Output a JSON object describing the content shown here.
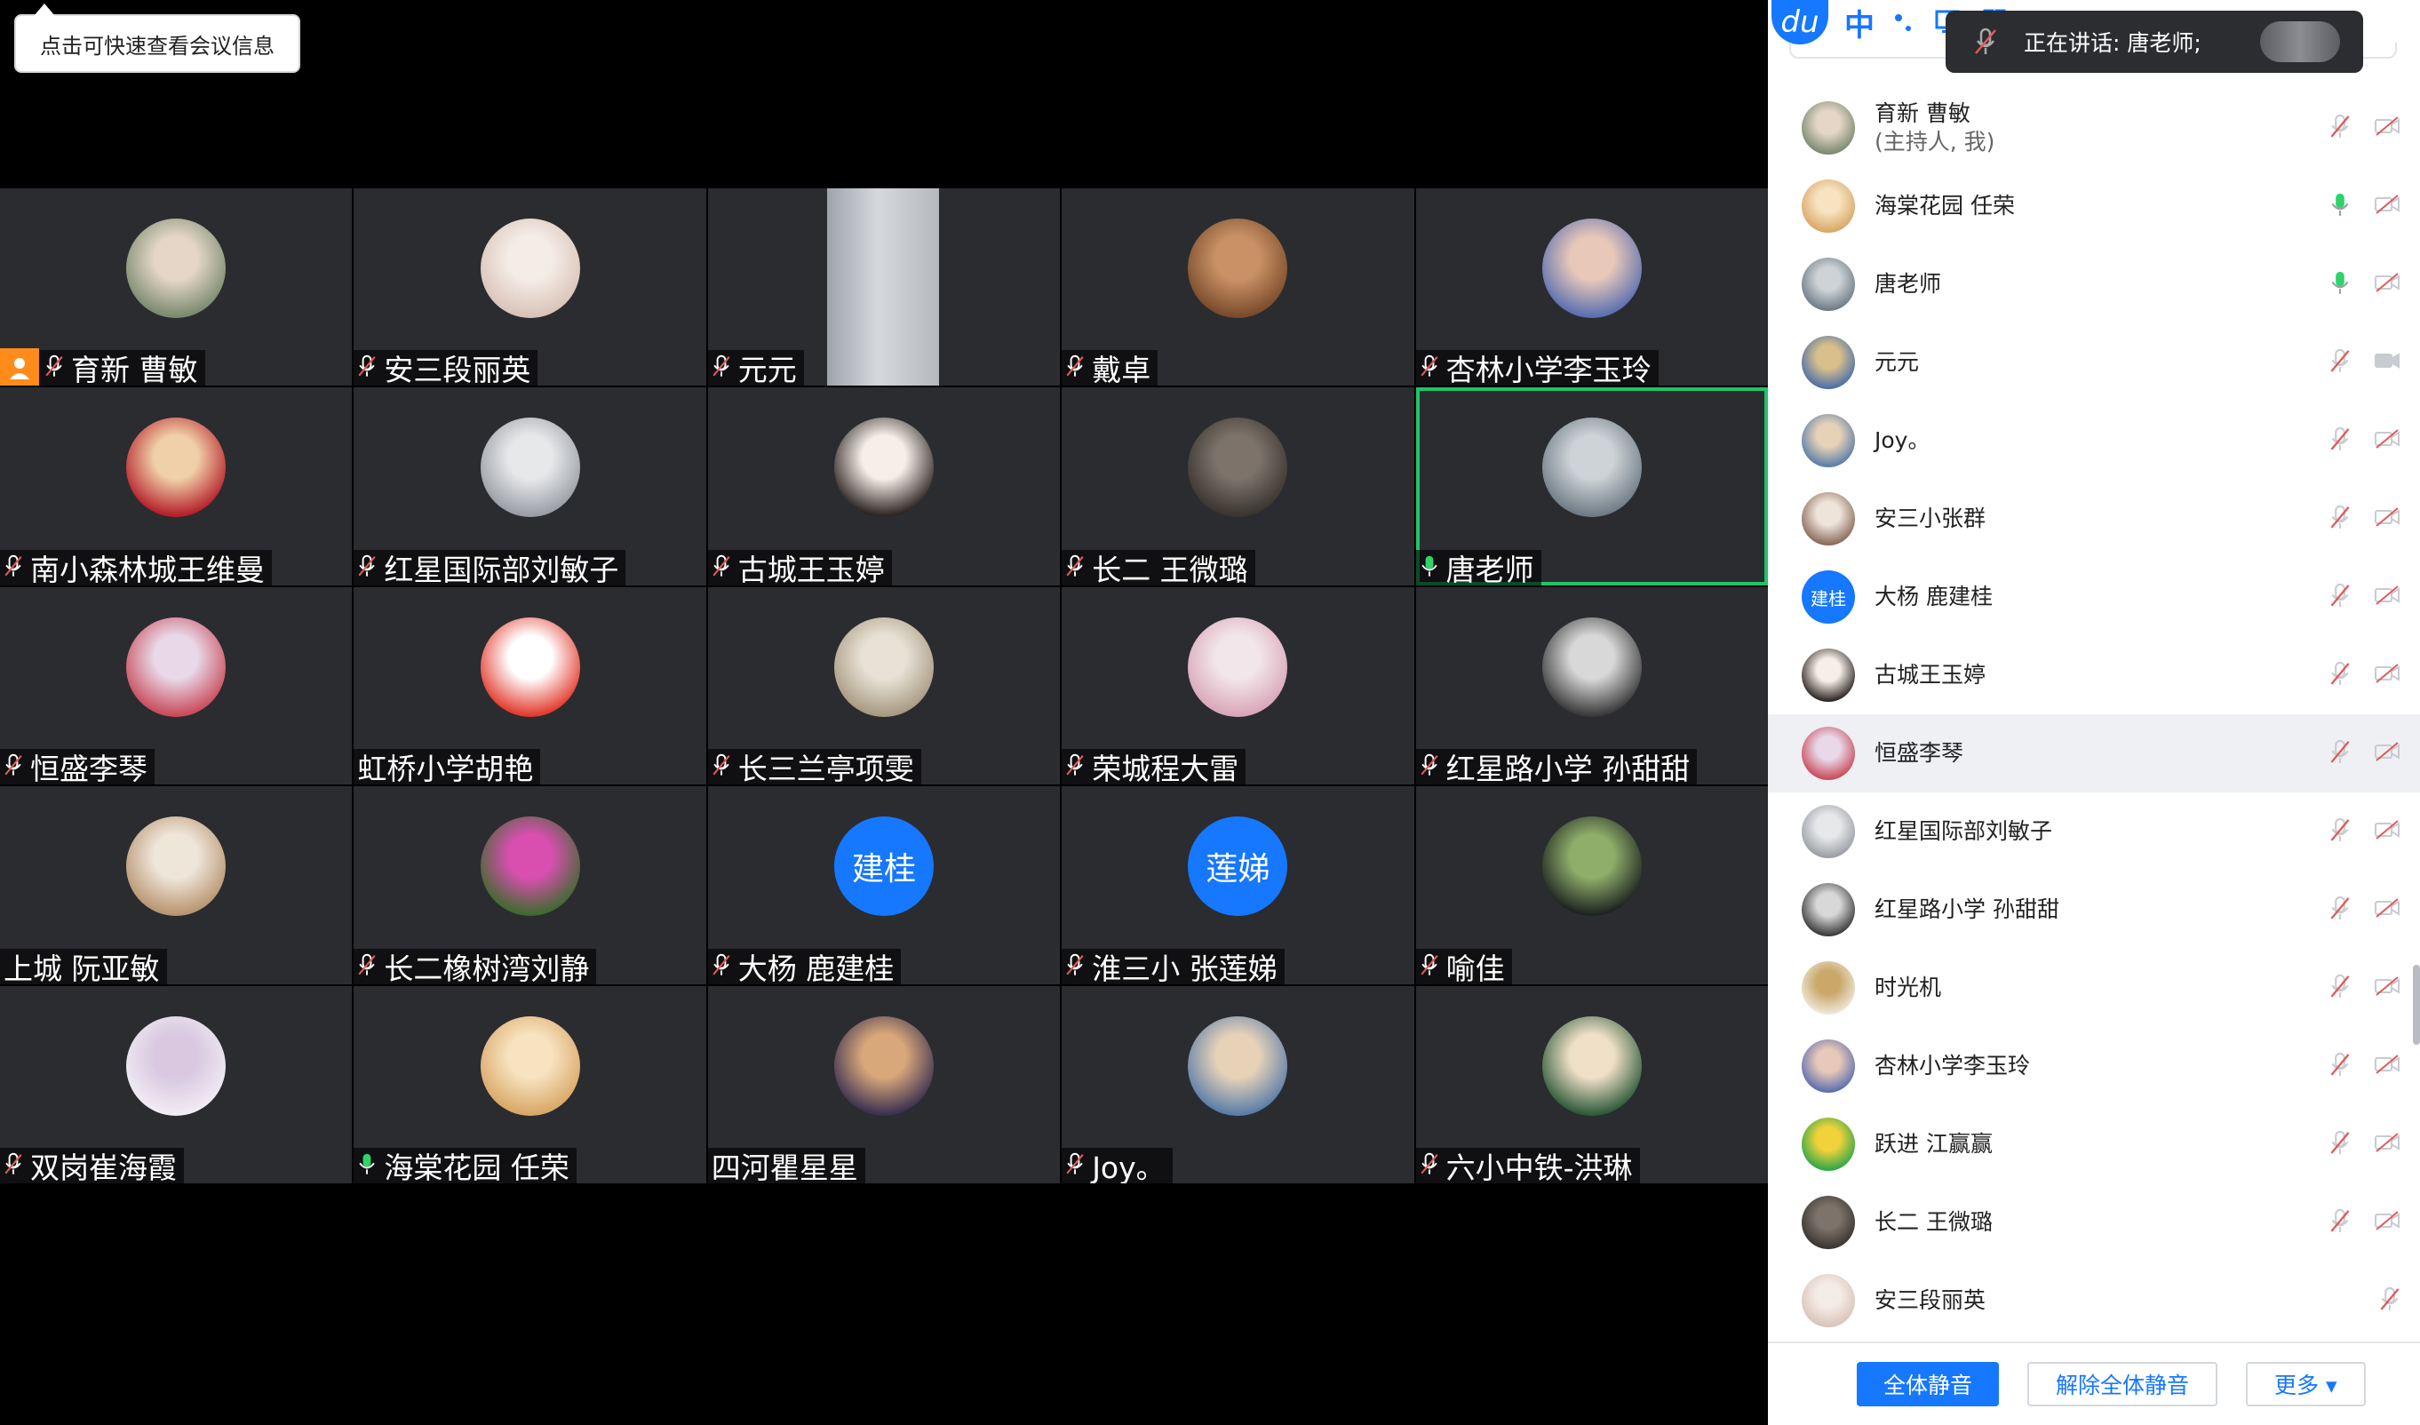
{
  "tooltip": {
    "text": "点击可快速查看会议信息"
  },
  "ime": {
    "logo": "du",
    "lang": "中"
  },
  "speaking": {
    "text": "正在讲话: 唐老师;"
  },
  "tiles": [
    {
      "name": "育新 曹敏",
      "host": true,
      "mic": "muted",
      "avatar": "photo",
      "c1": "#7a8a6e",
      "c2": "#e5d6c8"
    },
    {
      "name": "安三段丽英",
      "mic": "muted",
      "avatar": "photo",
      "c1": "#d9c3b8",
      "c2": "#f4ede6"
    },
    {
      "name": "元元",
      "mic": "muted",
      "avatar": "video"
    },
    {
      "name": "戴卓",
      "mic": "muted",
      "avatar": "photo",
      "c1": "#7a4b2b",
      "c2": "#c99266"
    },
    {
      "name": "杏林小学李玉玲",
      "mic": "muted",
      "avatar": "photo",
      "c1": "#5b6fb0",
      "c2": "#e8c8b8"
    },
    {
      "name": "南小森林城王维曼",
      "mic": "muted",
      "avatar": "photo",
      "c1": "#b5202a",
      "c2": "#f0d0a8"
    },
    {
      "name": "红星国际部刘敏子",
      "mic": "muted",
      "avatar": "photo",
      "c1": "#9a9ea4",
      "c2": "#e7e8ea"
    },
    {
      "name": "古城王玉婷",
      "mic": "muted",
      "avatar": "photo",
      "c1": "#2e2624",
      "c2": "#f6efe8"
    },
    {
      "name": "长二 王微璐",
      "mic": "muted",
      "avatar": "photo",
      "c1": "#3a3530",
      "c2": "#7d736a"
    },
    {
      "name": "唐老师",
      "mic": "on",
      "avatar": "photo",
      "active": true,
      "c1": "#6f7b86",
      "c2": "#cdd3d6"
    },
    {
      "name": "恒盛李琴",
      "mic": "muted",
      "avatar": "photo",
      "c1": "#c94b5a",
      "c2": "#e8d8e8"
    },
    {
      "name": "虹桥小学胡艳",
      "mic": "none",
      "avatar": "photo",
      "c1": "#e23b2e",
      "c2": "#ffffff"
    },
    {
      "name": "长三兰亭项雯",
      "mic": "muted",
      "avatar": "photo",
      "c1": "#a89a82",
      "c2": "#e8e2d6"
    },
    {
      "name": "荣城程大雷",
      "mic": "muted",
      "avatar": "photo",
      "c1": "#d9a6b8",
      "c2": "#f2e6ea"
    },
    {
      "name": "红星路小学 孙甜甜",
      "mic": "muted",
      "avatar": "photo",
      "c1": "#3a3a3a",
      "c2": "#d8d8d8"
    },
    {
      "name": "上城 阮亚敏",
      "mic": "none",
      "avatar": "photo",
      "c1": "#b89570",
      "c2": "#efe6da"
    },
    {
      "name": "长二橡树湾刘静",
      "mic": "muted",
      "avatar": "photo",
      "c1": "#3f6a2e",
      "c2": "#d94fb0"
    },
    {
      "name": "大杨 鹿建桂",
      "mic": "muted",
      "avatar": "text",
      "label": "建桂"
    },
    {
      "name": "淮三小 张莲娣",
      "mic": "muted",
      "avatar": "text",
      "label": "莲娣"
    },
    {
      "name": "喻佳",
      "mic": "muted",
      "avatar": "photo",
      "c1": "#1e2420",
      "c2": "#8fae6a"
    },
    {
      "name": "双岗崔海霞",
      "mic": "muted",
      "avatar": "photo",
      "c1": "#f1ecf4",
      "c2": "#d9c8e0"
    },
    {
      "name": "海棠花园 任荣",
      "mic": "on",
      "avatar": "photo",
      "c1": "#d9a766",
      "c2": "#f7e3c0"
    },
    {
      "name": "四河瞿星星",
      "mic": "none",
      "avatar": "photo",
      "c1": "#3b3150",
      "c2": "#d9a87a"
    },
    {
      "name": "Joy。",
      "mic": "muted",
      "avatar": "photo",
      "c1": "#5a7da8",
      "c2": "#e7d2b8"
    },
    {
      "name": "六小中铁-洪琳",
      "mic": "muted",
      "avatar": "photo",
      "c1": "#2f5b3a",
      "c2": "#f0e0c8"
    }
  ],
  "participants": [
    {
      "name": "育新 曹敏",
      "sub": "(主持人, 我)",
      "mic": "muted",
      "cam": "off",
      "c1": "#7a8a6e",
      "c2": "#e5d6c8"
    },
    {
      "name": "海棠花园 任荣",
      "mic": "on",
      "cam": "off",
      "c1": "#d9a766",
      "c2": "#f7e3c0"
    },
    {
      "name": "唐老师",
      "mic": "on",
      "cam": "off",
      "c1": "#6f7b86",
      "c2": "#cdd3d6"
    },
    {
      "name": "元元",
      "mic": "muted",
      "cam": "on",
      "c1": "#4b6fa8",
      "c2": "#d9c08a"
    },
    {
      "name": "Joy。",
      "mic": "muted",
      "cam": "off",
      "c1": "#5a7da8",
      "c2": "#e7d2b8"
    },
    {
      "name": "安三小张群",
      "mic": "muted",
      "cam": "off",
      "c1": "#8a6a5a",
      "c2": "#efe4da"
    },
    {
      "name": "大杨 鹿建桂",
      "mic": "muted",
      "cam": "off",
      "text": "建桂"
    },
    {
      "name": "古城王玉婷",
      "mic": "muted",
      "cam": "off",
      "c1": "#2e2624",
      "c2": "#f6efe8"
    },
    {
      "name": "恒盛李琴",
      "mic": "muted",
      "cam": "off",
      "highlight": true,
      "c1": "#c94b5a",
      "c2": "#e8d8e8"
    },
    {
      "name": "红星国际部刘敏子",
      "mic": "muted",
      "cam": "off",
      "c1": "#9a9ea4",
      "c2": "#e7e8ea"
    },
    {
      "name": "红星路小学 孙甜甜",
      "mic": "muted",
      "cam": "off",
      "c1": "#3a3a3a",
      "c2": "#d8d8d8"
    },
    {
      "name": "时光机",
      "mic": "muted",
      "cam": "off",
      "c1": "#efe7da",
      "c2": "#c9a86a"
    },
    {
      "name": "杏林小学李玉玲",
      "mic": "muted",
      "cam": "off",
      "c1": "#5b6fb0",
      "c2": "#e8c8b8"
    },
    {
      "name": "跃进 江赢赢",
      "mic": "muted",
      "cam": "off",
      "c1": "#2fa84a",
      "c2": "#f2d23a"
    },
    {
      "name": "长二 王微璐",
      "mic": "muted",
      "cam": "off",
      "c1": "#3a3530",
      "c2": "#7d736a"
    },
    {
      "name": "安三段丽英",
      "mic": "muted",
      "cam": "none",
      "c1": "#d9c3b8",
      "c2": "#f4ede6"
    }
  ],
  "footer": {
    "mute_all": "全体静音",
    "unmute_all": "解除全体静音",
    "more": "更多 ▾"
  },
  "colors": {
    "accent": "#1677ff",
    "active": "#1fc46a",
    "muted_red": "#e05a5a"
  }
}
